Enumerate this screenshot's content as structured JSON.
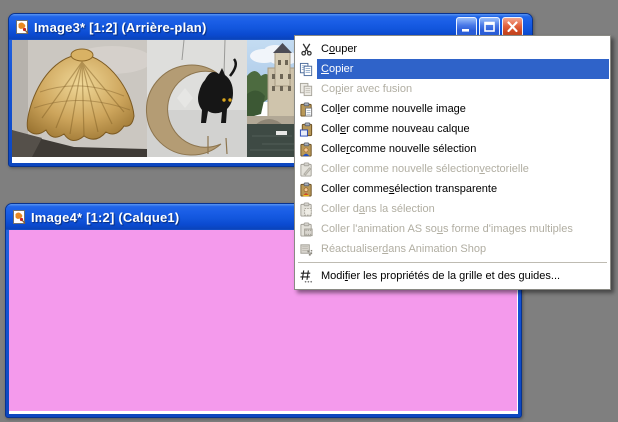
{
  "desktop": {
    "background_color": "#7f7f7f"
  },
  "windows": {
    "image3": {
      "title": "Image3* [1:2] (Arrière-plan)",
      "title_icon": "psp-image-icon",
      "controls": [
        "minimize-icon",
        "maximize-icon",
        "close-icon"
      ],
      "content": "photo collage: golden shell sculpture, cat-on-crescent-moon sign, riverside building"
    },
    "image4": {
      "title": "Image4* [1:2] (Calque1)",
      "title_icon": "psp-image-icon",
      "canvas_color": "#f49aec"
    }
  },
  "context_menu": {
    "highlighted_item": "Copier",
    "items": [
      {
        "icon": "scissors-icon",
        "pre": "C",
        "u": "o",
        "post": "uper",
        "state": "enabled"
      },
      {
        "icon": "copy-icon",
        "pre": "",
        "u": "C",
        "post": "opier",
        "state": "highlighted"
      },
      {
        "icon": "copy-merged-icon",
        "pre": "Co",
        "u": "p",
        "post": "ier avec fusion",
        "state": "disabled"
      },
      {
        "icon": "paste-new-image-icon",
        "pre": "Col",
        "u": "l",
        "post": "er comme nouvelle image",
        "state": "enabled"
      },
      {
        "icon": "paste-new-layer-icon",
        "pre": "Coll",
        "u": "e",
        "post": "r comme nouveau calque",
        "state": "enabled"
      },
      {
        "icon": "paste-new-selection-icon",
        "pre": "Colle",
        "u": "r",
        "post": " comme nouvelle sélection",
        "state": "enabled"
      },
      {
        "icon": "paste-vector-selection-icon",
        "pre": "Coller comme nouvelle sélection ",
        "u": "v",
        "post": "ectorielle",
        "state": "disabled"
      },
      {
        "icon": "paste-transparent-selection-icon",
        "pre": "Coller comme ",
        "u": "s",
        "post": "élection transparente",
        "state": "enabled"
      },
      {
        "icon": "paste-into-selection-icon",
        "pre": "Coller d",
        "u": "a",
        "post": "ns la sélection",
        "state": "disabled"
      },
      {
        "icon": "paste-animation-icon",
        "pre": "Coller l'animation AS so",
        "u": "u",
        "post": "s forme d'images multiples",
        "state": "disabled"
      },
      {
        "icon": "refresh-animation-shop-icon",
        "pre": "Réactualiser ",
        "u": "d",
        "post": "ans Animation Shop",
        "state": "disabled",
        "separator_after": true
      },
      {
        "icon": "grid-properties-icon",
        "pre": "Modi",
        "u": "f",
        "post": "ier les propriétés de la grille et des guides...",
        "state": "enabled"
      }
    ]
  },
  "colors": {
    "titlebar_blue": "#1a5ee6",
    "menu_highlight": "#2f63c9",
    "disabled_text": "#b1aea2",
    "canvas_pink": "#f49aec",
    "desktop_gray": "#7f7f7f"
  }
}
